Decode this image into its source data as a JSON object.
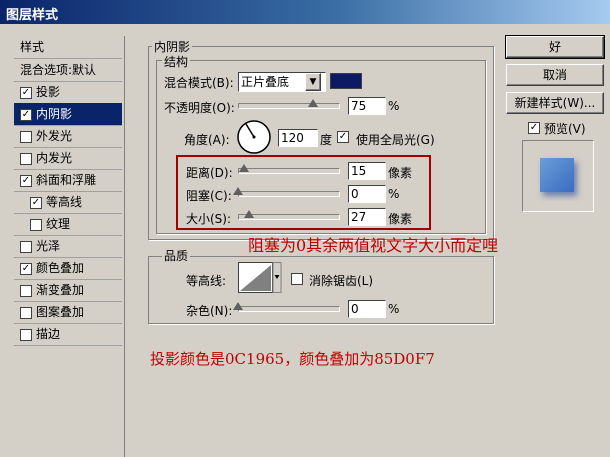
{
  "window": {
    "title": "图层样式"
  },
  "sidebar": {
    "header": "样式",
    "items": [
      {
        "label": "混合选项:默认",
        "checkbox": false,
        "checked": false
      },
      {
        "label": "投影",
        "checkbox": true,
        "checked": true
      },
      {
        "label": "内阴影",
        "checkbox": true,
        "checked": true,
        "selected": true
      },
      {
        "label": "外发光",
        "checkbox": true,
        "checked": false
      },
      {
        "label": "内发光",
        "checkbox": true,
        "checked": false
      },
      {
        "label": "斜面和浮雕",
        "checkbox": true,
        "checked": true
      },
      {
        "label": "等高线",
        "checkbox": true,
        "checked": true
      },
      {
        "label": "纹理",
        "checkbox": true,
        "checked": false
      },
      {
        "label": "光泽",
        "checkbox": true,
        "checked": false
      },
      {
        "label": "颜色叠加",
        "checkbox": true,
        "checked": true
      },
      {
        "label": "渐变叠加",
        "checkbox": true,
        "checked": false
      },
      {
        "label": "图案叠加",
        "checkbox": true,
        "checked": false
      },
      {
        "label": "描边",
        "checkbox": true,
        "checked": false
      }
    ]
  },
  "panel": {
    "section_title": "内阴影",
    "structure": {
      "title": "结构",
      "blend_mode_label": "混合模式(B):",
      "blend_mode_value": "正片叠底",
      "blend_color": "#0c1965",
      "opacity_label": "不透明度(O):",
      "opacity_value": "75",
      "opacity_unit": "%",
      "opacity_fraction": 0.75,
      "angle_label": "角度(A):",
      "angle_value": "120",
      "angle_unit": "度",
      "global_light_label": "使用全局光(G)",
      "global_light_checked": true,
      "distance_label": "距离(D):",
      "distance_value": "15",
      "distance_unit": "像素",
      "distance_fraction": 0.06,
      "choke_label": "阻塞(C):",
      "choke_value": "0",
      "choke_unit": "%",
      "choke_fraction": 0.0,
      "size_label": "大小(S):",
      "size_value": "27",
      "size_unit": "像素",
      "size_fraction": 0.11
    },
    "quality": {
      "title": "品质",
      "contour_label": "等高线:",
      "antialias_label": "消除锯齿(L)",
      "antialias_checked": false,
      "noise_label": "杂色(N):",
      "noise_value": "0",
      "noise_unit": "%",
      "noise_fraction": 0.0
    }
  },
  "buttons": {
    "ok": "好",
    "cancel": "取消",
    "new_style": "新建样式(W)...",
    "preview_label": "预览(V)",
    "preview_checked": true
  },
  "annotations": {
    "note1": "阻塞为0其余两值视文字大小而定哩",
    "note2": "投影颜色是0C1965，颜色叠加为85D0F7",
    "color": "#c00000"
  }
}
